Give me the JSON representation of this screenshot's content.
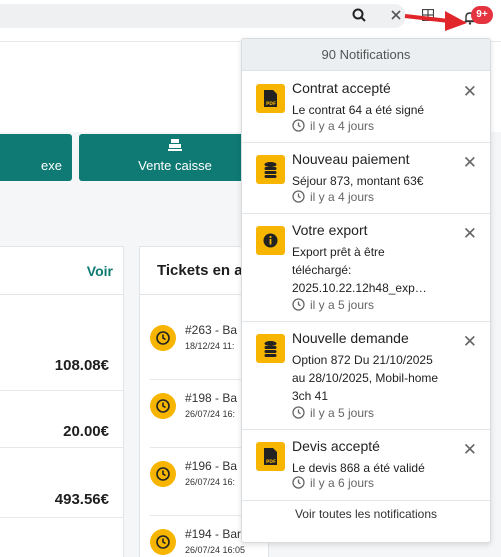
{
  "topbar": {
    "notification_badge": "9+"
  },
  "page": {
    "action_left_label": "exe",
    "action_vente_label": "Vente caisse",
    "left_panel": {
      "voir_label": "Voir",
      "amounts": [
        "108.08€",
        "20.00€",
        "493.56€"
      ]
    },
    "right_panel": {
      "title": "Tickets en a",
      "tickets": [
        {
          "line1": "#263 - Ba",
          "line2": "18/12/24 11:"
        },
        {
          "line1": "#198 - Ba",
          "line2": "26/07/24 16:"
        },
        {
          "line1": "#196 - Ba",
          "line2": "26/07/24 16:"
        },
        {
          "line1": "#194 - Bar",
          "line2": "26/07/24 16:05"
        }
      ]
    }
  },
  "notifications": {
    "header": "90 Notifications",
    "items": [
      {
        "icon": "pdf-icon",
        "title": "Contrat accepté",
        "body": "Le contrat 64 a été signé",
        "time": "il y a 4 jours"
      },
      {
        "icon": "coins-icon",
        "title": "Nouveau paiement",
        "body": "Séjour 873, montant 63€",
        "time": "il y a 4 jours"
      },
      {
        "icon": "info-icon",
        "title": "Votre export",
        "body": "Export prêt à être téléchargé: 2025.10.22.12h48_exp…",
        "time": "il y a 5 jours"
      },
      {
        "icon": "coins-icon",
        "title": "Nouvelle demande",
        "body": "Option 872 Du 21/10/2025 au 28/10/2025, Mobil-home 3ch 41",
        "time": "il y a 5 jours"
      },
      {
        "icon": "pdf-icon",
        "title": "Devis accepté",
        "body": "Le devis 868 a été validé",
        "time": "il y a 6 jours"
      }
    ],
    "footer": "Voir toutes les notifications"
  },
  "colors": {
    "accent": "#0e7a73",
    "icon_yellow": "#f7b500",
    "badge_red": "#e53340",
    "arrow_red": "#e0262b"
  }
}
